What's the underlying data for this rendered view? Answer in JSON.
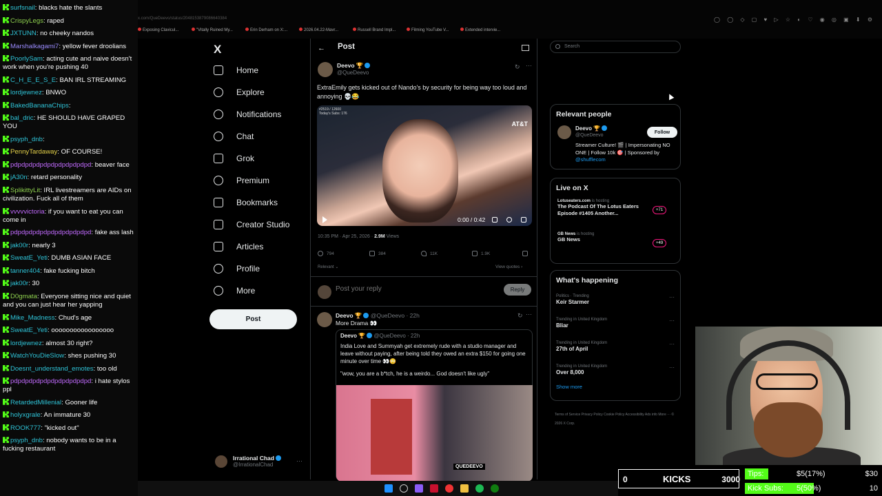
{
  "chat": [
    {
      "user": "surfsnail",
      "msg": "blacks hate the slants",
      "color": "#2fc4d8"
    },
    {
      "user": "CrispyLegs",
      "msg": "raped",
      "color": "#8fd14f"
    },
    {
      "user": "JXTUNN",
      "msg": "no cheeky nandos",
      "color": "#2fc4d8"
    },
    {
      "user": "Marshalkagami7",
      "msg": "yellow fever droolians",
      "color": "#9b8cff"
    },
    {
      "user": "PoorlySam",
      "msg": "acting cute and naive doesn't work when you're pushing 40",
      "color": "#2fc4d8"
    },
    {
      "user": "C_H_E_E_S_E",
      "msg": "BAN IRL STREAMING",
      "color": "#2fc4d8"
    },
    {
      "user": "lordjewnez",
      "msg": "BNWO",
      "color": "#2fc4d8"
    },
    {
      "user": "BakedBananaChips",
      "msg": "",
      "color": "#2fc4d8"
    },
    {
      "user": "bal_dric",
      "msg": "HE SHOULD HAVE GRAPED YOU",
      "color": "#2fc4d8"
    },
    {
      "user": "psyph_dnb",
      "msg": "",
      "color": "#2fc4d8"
    },
    {
      "user": "PennyTardaway",
      "msg": "OF COURSE!",
      "color": "#e6d34a"
    },
    {
      "user": "pdpdpdpdpdpdpdpdpdpdpd",
      "msg": "beaver face",
      "color": "#c26bff"
    },
    {
      "user": "jA30n",
      "msg": "retard personality",
      "color": "#2fc4d8"
    },
    {
      "user": "SplikittyLit",
      "msg": "IRL livestreamers are AIDs on civilization. Fuck all of them",
      "color": "#8fd14f"
    },
    {
      "user": "vvvvvictoria",
      "msg": "if you want to eat you can come in",
      "color": "#c26bff"
    },
    {
      "user": "pdpdpdpdpdpdpdpdpdpdpd",
      "msg": "fake ass lash",
      "color": "#c26bff"
    },
    {
      "user": "jak00r",
      "msg": "nearly 3",
      "color": "#2fc4d8"
    },
    {
      "user": "SweatE_Yeti",
      "msg": "DUMB ASIAN FACE",
      "color": "#2fc4d8"
    },
    {
      "user": "tanner404",
      "msg": "fake fucking bitch",
      "color": "#2fc4d8"
    },
    {
      "user": "jak00r",
      "msg": "30",
      "color": "#2fc4d8"
    },
    {
      "user": "D0gmata",
      "msg": "Everyone sitting nice and quiet and you can just hear her yapping",
      "color": "#8fd14f"
    },
    {
      "user": "Mike_Madness",
      "msg": "Chud's age",
      "color": "#2fc4d8"
    },
    {
      "user": "SweatE_Yeti",
      "msg": "ooooooooooooooooo",
      "color": "#2fc4d8"
    },
    {
      "user": "lordjewnez",
      "msg": "almost 30 right?",
      "color": "#2fc4d8"
    },
    {
      "user": "WatchYouDieSlow",
      "msg": "shes pushing 30",
      "color": "#2fc4d8"
    },
    {
      "user": "Doesnt_understand_emotes",
      "msg": "too old",
      "color": "#2fc4d8"
    },
    {
      "user": "pdpdpdpdpdpdpdpdpdpdpd",
      "msg": "i hate stylos ppl",
      "color": "#c26bff"
    },
    {
      "user": "RetardedMillenial",
      "msg": "Gooner life",
      "color": "#2fc4d8"
    },
    {
      "user": "holyxgrale",
      "msg": "An immature 30",
      "color": "#2fc4d8"
    },
    {
      "user": "ROOK777",
      "msg": "\"kicked out\"",
      "color": "#2fc4d8"
    },
    {
      "user": "psyph_dnb",
      "msg": "nobody wants to be in a fucking restaurant",
      "color": "#2fc4d8"
    }
  ],
  "browser": {
    "url": "x.com/QueDeevo/status/2048153879086640384",
    "bookmarks": [
      "Exposing Clavicul...",
      "\"Vitally Ruined My...",
      "Erin Derham on X:...",
      "2026.04.22-Mavr...",
      "Russell Brand Impl...",
      "Filming YouTube V...",
      "Extended intervie..."
    ]
  },
  "nav": {
    "logo": "X",
    "items": [
      "Home",
      "Explore",
      "Notifications",
      "Chat",
      "Grok",
      "Premium",
      "Bookmarks",
      "Creator Studio",
      "Articles",
      "Profile",
      "More"
    ],
    "post_button": "Post",
    "account_name": "Irrational Chad",
    "account_handle": "@IrrationalChad"
  },
  "post": {
    "header": "Post",
    "author": "Deevo 🏆",
    "handle": "@QueDeevo",
    "text": "ExtraEmily gets kicked out of Nando's by security for being way too loud and annoying 💀😂",
    "video_stats": "#2519 / 12600\nToday's Subs: 176",
    "video_watermark": "AT&T",
    "video_time": "0:00 / 0:42",
    "timestamp": "10:35 PM · Apr 25, 2026 · ",
    "views_count": "2.9M",
    "views_label": " Views",
    "replies": "794",
    "reposts": "384",
    "likes": "11K",
    "bookmarks": "1.9K",
    "relevant": "Relevant ⌄",
    "view_quotes": "View quotes ›",
    "reply_placeholder": "Post your reply",
    "reply_button": "Reply"
  },
  "reply": {
    "author": "Deevo 🏆",
    "handle": "@QueDeevo · 22h",
    "text": "More Drama 👀",
    "quote_author": "Deevo 🏆",
    "quote_handle": "@QueDeevo · 22h",
    "quote_text": "India Love and Summyah get extremely rude with a studio manager and leave without paying, after being told they owed an extra $150 for going one minute over time 👀😳",
    "quote_text2": "\"wow, you are a b*tch, he is a weirdo... God doesn't like ugly\"",
    "quote_watermark": "QUEDEEVO"
  },
  "sidebar": {
    "search_placeholder": "Search",
    "relevant_title": "Relevant people",
    "rp_name": "Deevo 🏆",
    "rp_handle": "@QueDeevo",
    "follow": "Follow",
    "rp_bio": "Streamer Culture! 🎬 | Impersonating NO ONE | Follow 10k 🎯 | Sponsored by ",
    "rp_bio_link": "@shufflecom",
    "live_title": "Live on X",
    "live": [
      {
        "host": "Lotuseaters.com",
        "status": " is hosting",
        "title": "The Podcast Of The Lotus Eaters Episode #1405 Another...",
        "count": "+71"
      },
      {
        "host": "GB News",
        "status": " is hosting",
        "title": "GB News",
        "count": "+49"
      }
    ],
    "happening_title": "What's happening",
    "trends": [
      {
        "ctx": "Politics · Trending",
        "name": "Keir Starmer"
      },
      {
        "ctx": "Trending in United Kingdom",
        "name": "Bliar"
      },
      {
        "ctx": "Trending in United Kingdom",
        "name": "27th of April"
      },
      {
        "ctx": "Trending in United Kingdom",
        "name": "Over 8,000"
      }
    ],
    "show_more": "Show more",
    "footer": "Terms of Service   Privacy Policy   Cookie Policy   Accessibility   Ads info   More ···   © 2026 X Corp."
  },
  "overlay": {
    "kicks_count": "0",
    "kicks_label": "KICKS",
    "kicks_goal": "3000",
    "tips_label": "Tips:",
    "tips_value": "$5(17%)",
    "tips_goal": "$30",
    "tips_fraction": 0.17,
    "subs_label": "Kick Subs:",
    "subs_value": "5(50%)",
    "subs_goal": "10",
    "subs_fraction": 0.5
  },
  "colors": {
    "accent": "#1d9bf0",
    "kick_green": "#53fc18",
    "live_ring": "#f91880"
  }
}
